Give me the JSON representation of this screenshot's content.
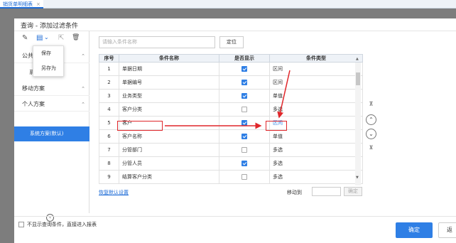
{
  "top_tab": {
    "label": "销货单明细表",
    "close": "×"
  },
  "dialog": {
    "title": "查询 - 添加过滤条件"
  },
  "toolbar": {
    "edit_icon": "✎",
    "save_icon": "▤",
    "dropdown_icon": "⌄",
    "export_icon": "⇱",
    "delete_icon": "🗑"
  },
  "save_menu": {
    "items": [
      "保存",
      "另存为"
    ]
  },
  "left_panel": {
    "public": {
      "label": "公共",
      "partial": "系"
    },
    "mobile": {
      "label": "移动方案"
    },
    "personal": {
      "label": "个人方案"
    },
    "selected_item": "系统方案(默认)",
    "collapse_icon": "‹"
  },
  "search": {
    "placeholder": "请输入条件名称"
  },
  "locate_button": "定位",
  "table": {
    "headers": [
      "序号",
      "条件名称",
      "是否显示",
      "条件类型"
    ],
    "rows": [
      {
        "no": "1",
        "name": "单据日期",
        "shown": true,
        "type": "区间"
      },
      {
        "no": "2",
        "name": "单据编号",
        "shown": true,
        "type": "区间"
      },
      {
        "no": "3",
        "name": "业务类型",
        "shown": true,
        "type": "单值"
      },
      {
        "no": "4",
        "name": "客户分类",
        "shown": false,
        "type": "多选"
      },
      {
        "no": "5",
        "name": "客户",
        "shown": true,
        "type": "区间"
      },
      {
        "no": "6",
        "name": "客户名称",
        "shown": true,
        "type": "单值"
      },
      {
        "no": "7",
        "name": "分管部门",
        "shown": false,
        "type": "多选"
      },
      {
        "no": "8",
        "name": "分管人员",
        "shown": true,
        "type": "多选"
      },
      {
        "no": "9",
        "name": "结算客户分类",
        "shown": false,
        "type": "多选"
      }
    ]
  },
  "restore_default": "恢复默认设置",
  "move_to": {
    "label": "移动到",
    "confirm": "确定"
  },
  "side_nav": {
    "top": "⊼",
    "up": "⌃",
    "down": "⌄",
    "bottom": "⊻"
  },
  "footer": {
    "skip_label": "不显示查询条件，直接进入报表",
    "ok": "确定",
    "back": "返"
  }
}
